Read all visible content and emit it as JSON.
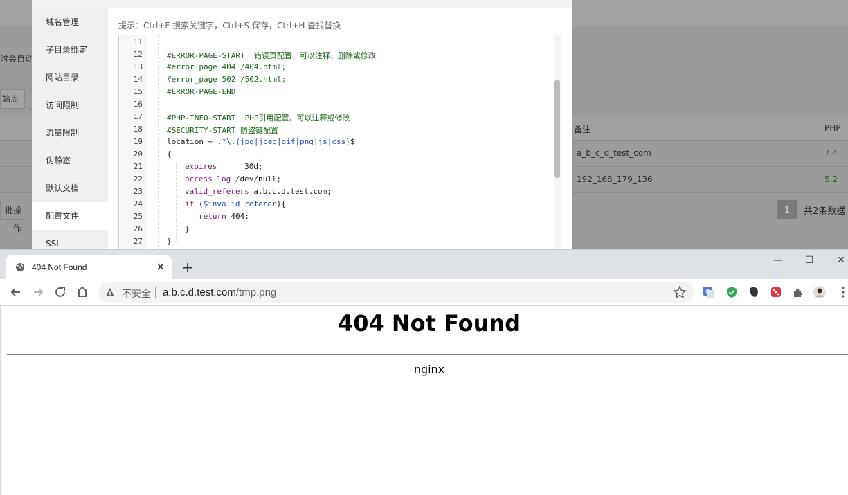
{
  "background": {
    "hint_fragment": "时会自动创",
    "button_fragment": "站点",
    "table_headers": {
      "remark": "备注",
      "php": "PHP"
    },
    "rows": [
      {
        "remark": "a_b_c_d_test_com",
        "php": "7.4"
      },
      {
        "remark": "192_168_179_136",
        "php": "5.2"
      }
    ],
    "bulk_button": "批操作",
    "pager": {
      "current": "1",
      "summary": "共2条数据"
    }
  },
  "modal": {
    "sidebar": [
      "域名管理",
      "子目录绑定",
      "网站目录",
      "访问限制",
      "流量限制",
      "伪静态",
      "默认文档",
      "配置文件",
      "SSL"
    ],
    "active_index": 7,
    "hint": "提示：Ctrl+F 搜索关键字，Ctrl+S 保存，Ctrl+H 查找替换",
    "editor": {
      "line_numbers": [
        "11",
        "12",
        "13",
        "14",
        "15",
        "16",
        "17",
        "18",
        "19",
        "20",
        "21",
        "22",
        "23",
        "24",
        "25",
        "26",
        "27"
      ],
      "lines": {
        "l12": "#ERROR-PAGE-START  错误页配置，可以注释、删除或修改",
        "l13": "#error_page 404 /404.html;",
        "l14": "#error_page 502 /502.html;",
        "l15": "#ERROR-PAGE-END",
        "l17": "#PHP-INFO-START  PHP引用配置，可以注释或修改",
        "l18": "#SECURITY-START 防盗链配置",
        "l19_a": "location ~ ",
        "l19_b": ".*\\.(jpg|jpeg|gif|png|js|css)",
        "l19_c": "$",
        "l20": "{",
        "l21_kw": "expires",
        "l21_val": "      30d;",
        "l22_kw": "access_log",
        "l22_val": " /dev/null;",
        "l23_kw": "valid_referers",
        "l23_val": " a.b.c.d.test.com;",
        "l24_kw": "if",
        "l24_a": " (",
        "l24_var": "$invalid_referer",
        "l24_b": "){",
        "l25_kw": "return",
        "l25_val": " 404;",
        "l26": "}",
        "l27": "}"
      }
    }
  },
  "browser": {
    "tab_title": "404 Not Found",
    "new_tab": "+",
    "window": {
      "minimize": "—",
      "maximize": "☐",
      "close": "✕"
    },
    "insecure_label": "不安全",
    "url_host": "a.b.c.d.test.com",
    "url_path": "/tmp.png",
    "page": {
      "heading": "404 Not Found",
      "footer": "nginx"
    }
  }
}
